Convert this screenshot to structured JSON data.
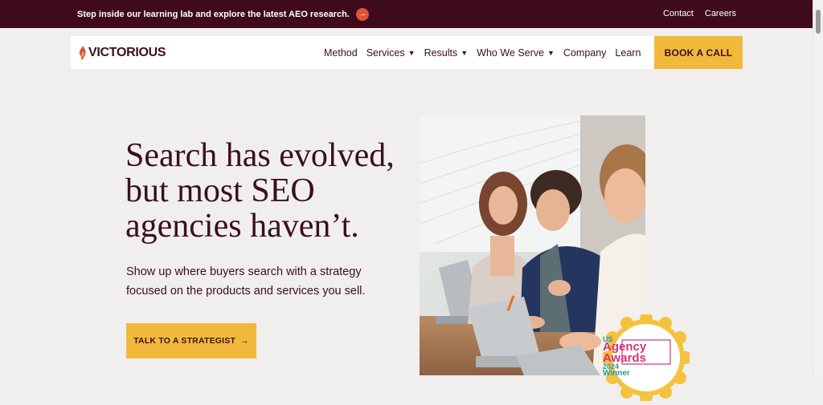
{
  "announcement": {
    "text": "Step inside our learning lab and explore the latest AEO research.",
    "arrow": "→"
  },
  "utility_links": {
    "contact": "Contact",
    "careers": "Careers"
  },
  "nav": {
    "logo": "VICTORIOUS",
    "items": [
      {
        "label": "Method",
        "dropdown": false
      },
      {
        "label": "Services",
        "dropdown": true
      },
      {
        "label": "Results",
        "dropdown": true
      },
      {
        "label": "Who We Serve",
        "dropdown": true
      },
      {
        "label": "Company",
        "dropdown": false
      },
      {
        "label": "Learn",
        "dropdown": false
      }
    ],
    "cta": "BOOK A CALL"
  },
  "hero": {
    "headline_line1": "Search has evolved,",
    "headline_line2": "but most SEO",
    "headline_line3": "agencies haven’t.",
    "subtext_line1": "Show up where buyers search with a strategy",
    "subtext_line2": "focused on the products and services you sell.",
    "cta": "TALK TO A STRATEGIST",
    "cta_arrow": "→"
  },
  "award": {
    "country": "US",
    "line1": "Agency",
    "line2": "Awards",
    "year": "2024",
    "status": "Winner"
  },
  "colors": {
    "topbar": "#3f0b1c",
    "accent": "#f1b93c",
    "text": "#3b0f1f",
    "background": "#f0efed",
    "arrow_circle": "#e0523a"
  }
}
